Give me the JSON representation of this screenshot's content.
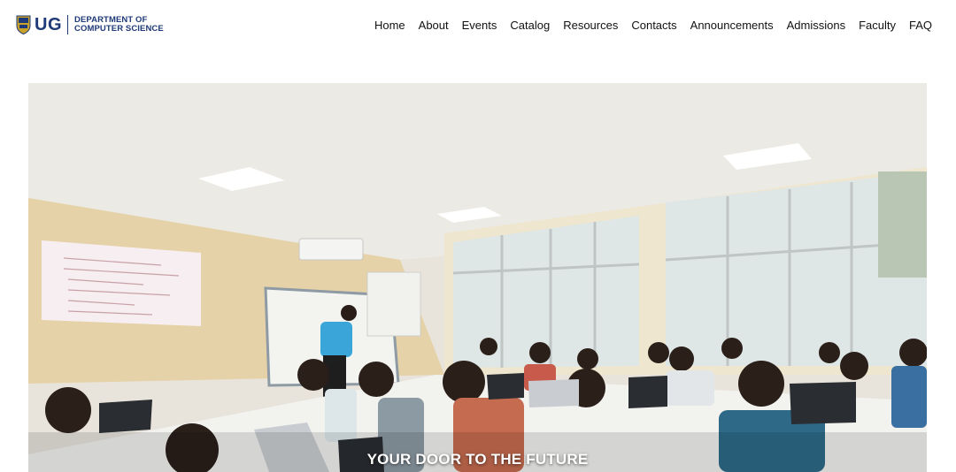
{
  "brand": {
    "abbr": "UG",
    "line1": "DEPARTMENT OF",
    "line2": "COMPUTER SCIENCE",
    "color": "#1f3a78"
  },
  "nav": {
    "items": [
      "Home",
      "About",
      "Events",
      "Catalog",
      "Resources",
      "Contacts",
      "Announcements",
      "Admissions",
      "Faculty",
      "FAQ"
    ]
  },
  "hero": {
    "caption": "YOUR DOOR TO THE FUTURE"
  }
}
